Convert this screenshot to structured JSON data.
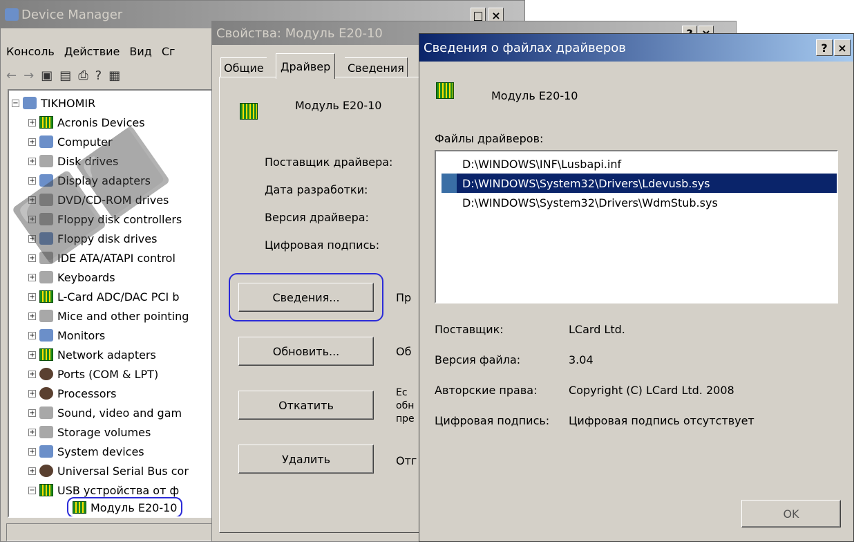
{
  "device_manager": {
    "title": "Device Manager",
    "menu": [
      "Консоль",
      "Действие",
      "Вид",
      "Сг"
    ],
    "tree_root": "TIKHOMIR",
    "tree_items": [
      {
        "label": "Acronis Devices",
        "icon": "card-icon"
      },
      {
        "label": "Computer",
        "icon": "computer-icon"
      },
      {
        "label": "Disk drives",
        "icon": "disk-icon"
      },
      {
        "label": "Display adapters",
        "icon": "display-icon"
      },
      {
        "label": "DVD/CD-ROM drives",
        "icon": "dvd-icon"
      },
      {
        "label": "Floppy disk controllers",
        "icon": "controller-icon"
      },
      {
        "label": "Floppy disk drives",
        "icon": "floppy-icon"
      },
      {
        "label": "IDE ATA/ATAPI control",
        "icon": "controller-icon"
      },
      {
        "label": "Keyboards",
        "icon": "keyboard-icon"
      },
      {
        "label": "L-Card ADC/DAC PCI b",
        "icon": "card-icon"
      },
      {
        "label": "Mice and other pointing",
        "icon": "mouse-icon"
      },
      {
        "label": "Monitors",
        "icon": "monitor-icon"
      },
      {
        "label": "Network adapters",
        "icon": "card-icon"
      },
      {
        "label": "Ports (COM & LPT)",
        "icon": "port-icon"
      },
      {
        "label": "Processors",
        "icon": "processor-icon"
      },
      {
        "label": "Sound, video and gam",
        "icon": "sound-icon"
      },
      {
        "label": "Storage volumes",
        "icon": "disk-icon"
      },
      {
        "label": "System devices",
        "icon": "computer-icon"
      },
      {
        "label": "Universal Serial Bus cor",
        "icon": "usb-icon"
      },
      {
        "label": "USB устройства от ф",
        "icon": "card-icon"
      }
    ],
    "selected_child": "Модуль E20-10"
  },
  "props": {
    "title": "Свойства: Модуль E20-10",
    "tabs": [
      "Общие",
      "Драйвер",
      "Сведения"
    ],
    "device_name": "Модуль E20-10",
    "fields": [
      "Поставщик драйвера:",
      "Дата разработки:",
      "Версия драйвера:",
      "Цифровая подпись:"
    ],
    "buttons": [
      "Сведения...",
      "Обновить...",
      "Откатить",
      "Удалить"
    ],
    "button_desc": [
      "Пр",
      "Об",
      "Ес\nобн\nпре",
      "Отг"
    ]
  },
  "details": {
    "title": "Сведения о файлах драйверов",
    "help_btn": "?",
    "close_btn": "×",
    "device_name": "Модуль E20-10",
    "files_label": "Файлы драйверов:",
    "files": [
      "D:\\WINDOWS\\INF\\Lusbapi.inf",
      "D:\\WINDOWS\\System32\\Drivers\\Ldevusb.sys",
      "D:\\WINDOWS\\System32\\Drivers\\WdmStub.sys"
    ],
    "selected_index": 1,
    "info": [
      {
        "label": "Поставщик:",
        "value": "LCard Ltd."
      },
      {
        "label": "Версия файла:",
        "value": "3.04"
      },
      {
        "label": "Авторские права:",
        "value": "Copyright (C) LCard Ltd. 2008"
      },
      {
        "label": "Цифровая подпись:",
        "value": "Цифровая подпись отсутствует"
      }
    ],
    "ok": "OK"
  },
  "colors": {
    "title_active": "#0a246a",
    "selection": "#0a246a",
    "highlight_ring": "#2b2bd8"
  }
}
